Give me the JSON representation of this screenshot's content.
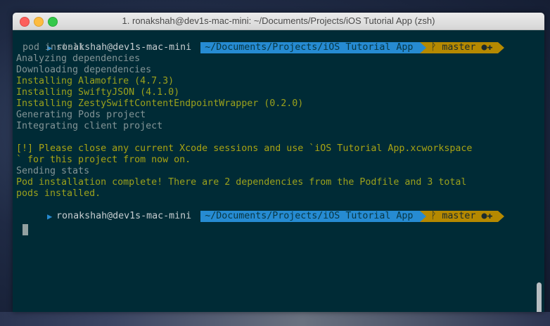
{
  "window": {
    "title": "1. ronakshah@dev1s-mac-mini: ~/Documents/Projects/iOS Tutorial App (zsh)"
  },
  "prompt": {
    "user_host": "ronakshah@dev1s-mac-mini",
    "path": "~/Documents/Projects/iOS Tutorial App",
    "branch": "master",
    "git_status": "●✚"
  },
  "terminal": {
    "command": "pod install",
    "lines": [
      "Analyzing dependencies",
      "Downloading dependencies",
      "Installing Alamofire (4.7.3)",
      "Installing SwiftyJSON (4.1.0)",
      "Installing ZestySwiftContentEndpointWrapper (0.2.0)",
      "Generating Pods project",
      "Integrating client project",
      "",
      "[!] Please close any current Xcode sessions and use `iOS Tutorial App.xcworkspace",
      "` for this project from now on.",
      "Sending stats",
      "Pod installation complete! There are 2 dependencies from the Podfile and 3 total",
      "pods installed."
    ]
  },
  "colors": {
    "background": "#002b36",
    "path_segment": "#268bd2",
    "git_segment": "#b58900",
    "highlight_text": "#9ba11c"
  },
  "icons": {
    "prompt_marker": "triangle-right-icon",
    "branch": "git-branch-icon"
  }
}
